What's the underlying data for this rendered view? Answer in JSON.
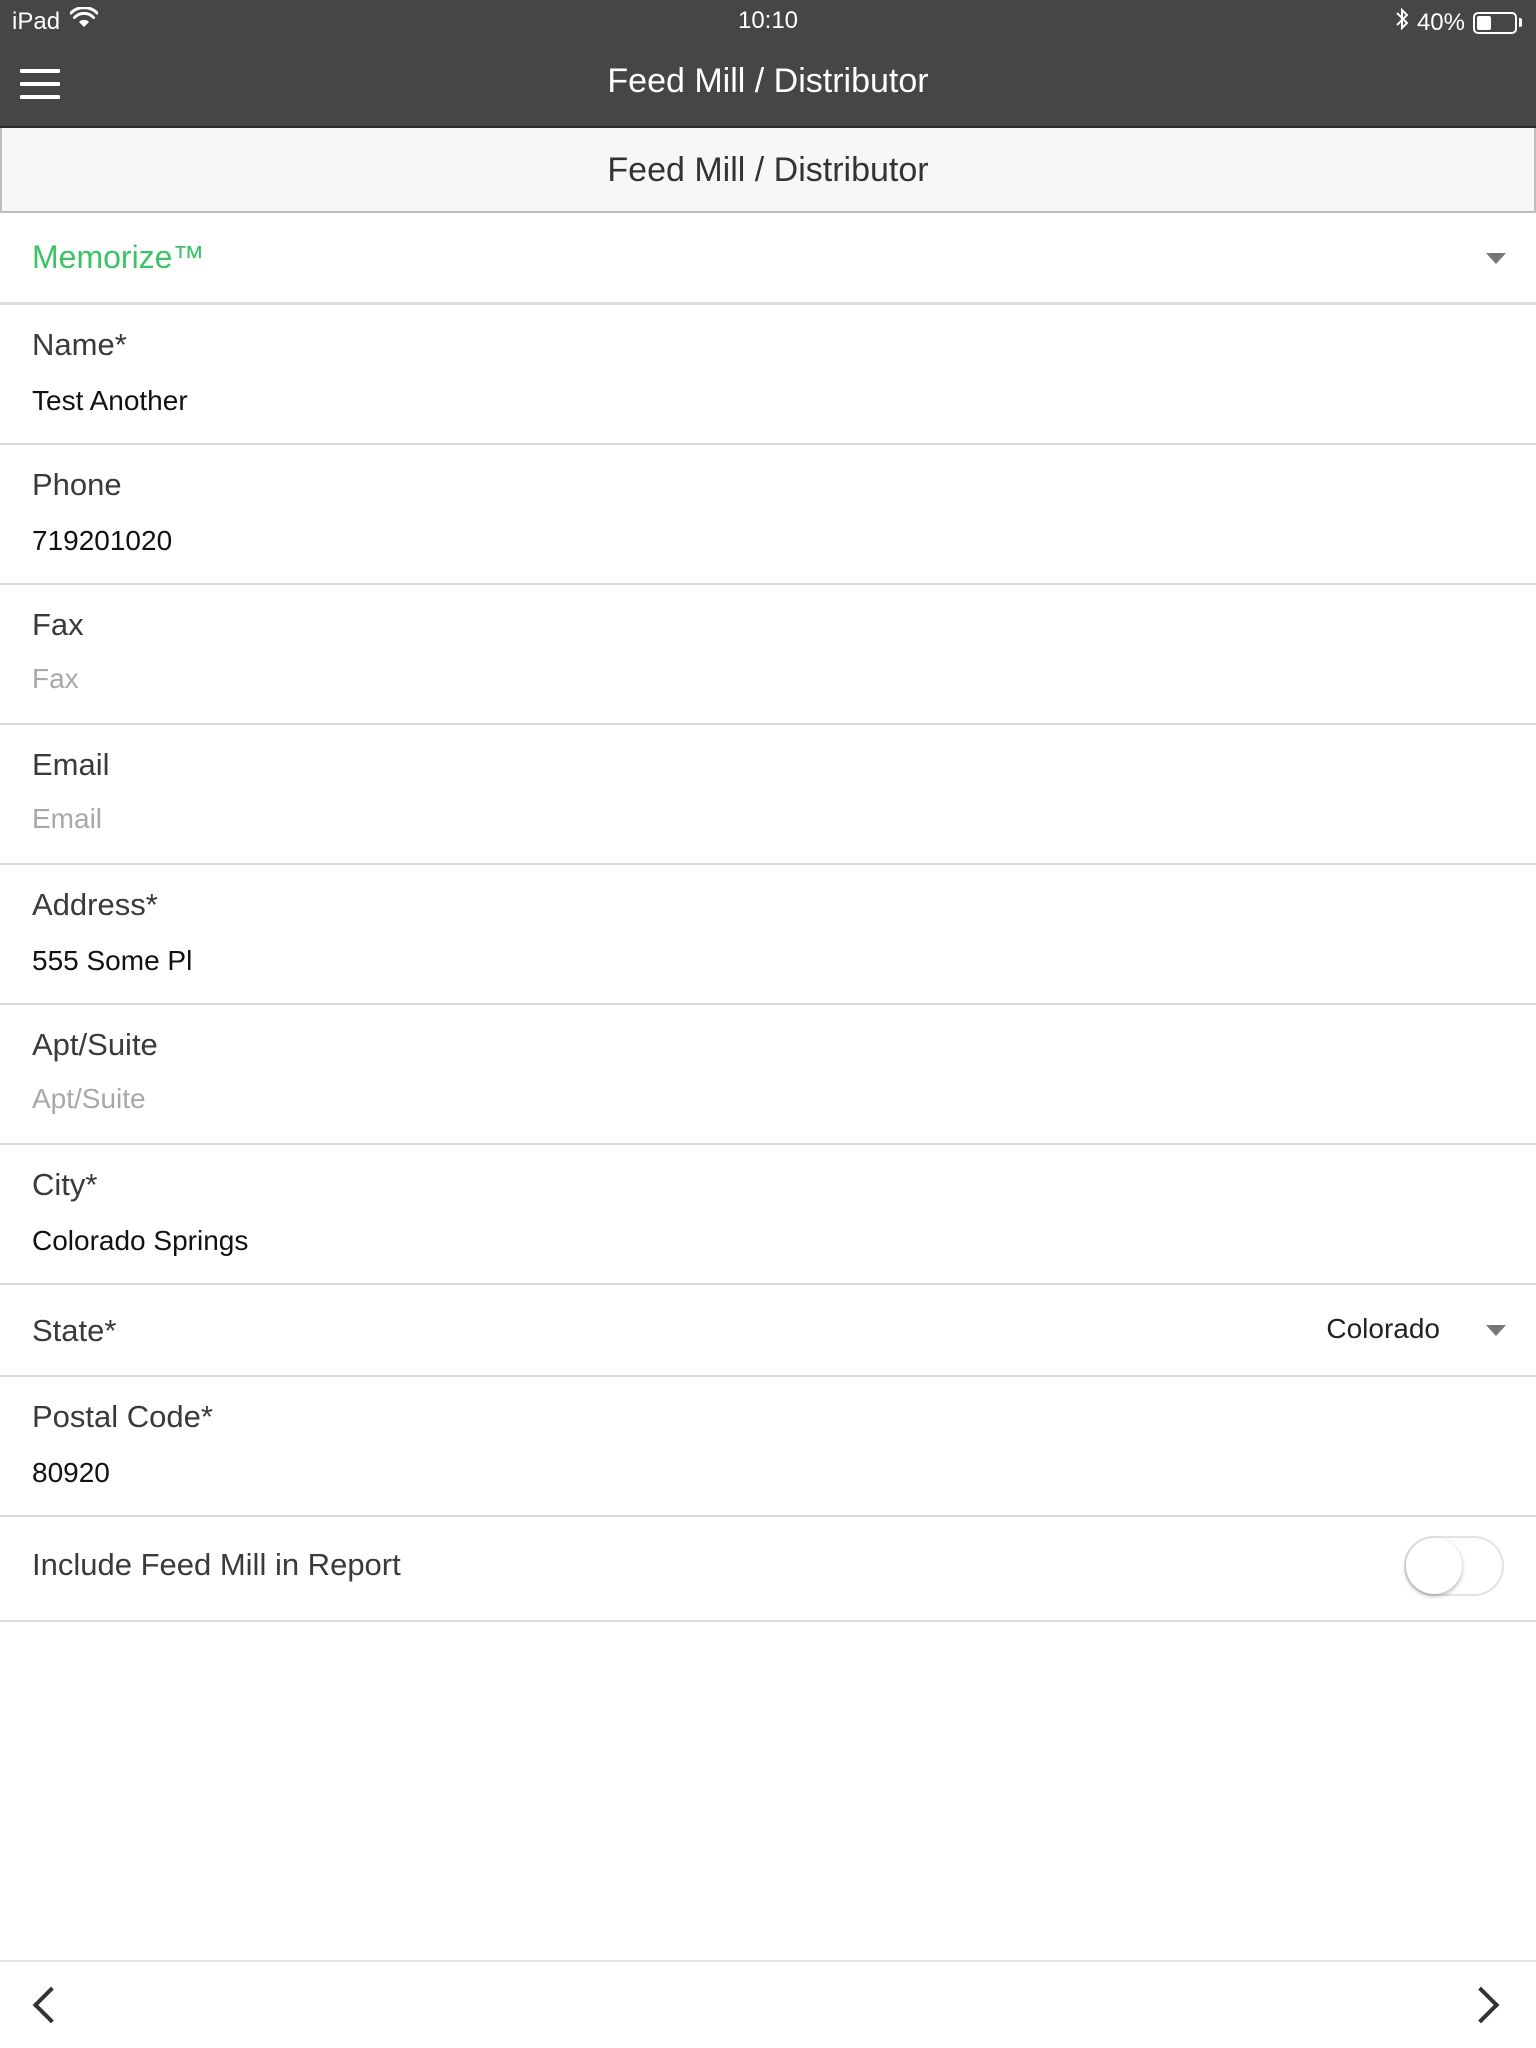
{
  "status_bar": {
    "device": "iPad",
    "time": "10:10",
    "battery_text": "40%",
    "battery_level": 0.4
  },
  "nav": {
    "title": "Feed Mill / Distributor"
  },
  "section": {
    "title": "Feed Mill / Distributor"
  },
  "memorize": {
    "label": "Memorize™",
    "color": "#3cc464"
  },
  "fields": {
    "name": {
      "label": "Name*",
      "value": "Test Another",
      "placeholder": ""
    },
    "phone": {
      "label": "Phone",
      "value": "719201020",
      "placeholder": ""
    },
    "fax": {
      "label": "Fax",
      "value": "",
      "placeholder": "Fax"
    },
    "email": {
      "label": "Email",
      "value": "",
      "placeholder": "Email"
    },
    "address": {
      "label": "Address*",
      "value": "555 Some Pl",
      "placeholder": ""
    },
    "apt": {
      "label": "Apt/Suite",
      "value": "",
      "placeholder": "Apt/Suite"
    },
    "city": {
      "label": "City*",
      "value": "Colorado Springs",
      "placeholder": ""
    },
    "state": {
      "label": "State*",
      "value": "Colorado"
    },
    "postal": {
      "label": "Postal Code*",
      "value": "80920",
      "placeholder": ""
    }
  },
  "include_report": {
    "label": "Include Feed Mill in Report",
    "enabled": false
  },
  "icons": {
    "menu": "hamburger-menu-icon",
    "back": "chevron-left-icon",
    "forward": "chevron-right-icon",
    "dropdown": "caret-down-icon",
    "wifi": "wifi-icon",
    "bluetooth": "bluetooth-icon",
    "battery": "battery-icon"
  }
}
